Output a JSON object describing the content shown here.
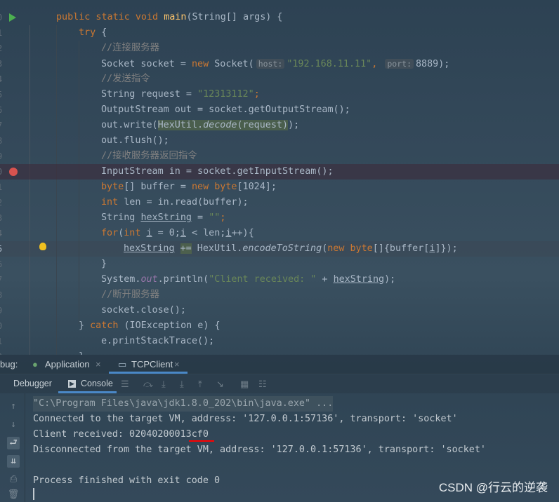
{
  "editor": {
    "line_numbers": [
      "0",
      "1",
      "2",
      "3",
      "4",
      "5",
      "6",
      "7",
      "8",
      "9",
      "0",
      "1",
      "2",
      "3",
      "4",
      "5",
      "6",
      "7",
      "8",
      "9",
      "0",
      "1",
      "2"
    ],
    "lines": [
      [
        [
          "public static void ",
          "kw"
        ],
        [
          "main",
          "fn"
        ],
        [
          "(String[] args) {",
          ""
        ]
      ],
      [
        [
          "try ",
          "kw"
        ],
        [
          "{",
          ""
        ]
      ],
      [
        [
          "//连接服务器",
          "cm"
        ]
      ],
      [
        [
          "Socket socket = ",
          ""
        ],
        [
          "new ",
          "kw"
        ],
        [
          "Socket(",
          ""
        ],
        [
          "host:",
          "hint"
        ],
        [
          "\"192.168.11.11\"",
          "str"
        ],
        [
          ", ",
          "kw"
        ],
        [
          "port:",
          "hint"
        ],
        [
          "8889",
          ""
        ],
        [
          ");",
          ""
        ]
      ],
      [
        [
          "//发送指令",
          "cm"
        ]
      ],
      [
        [
          "String request = ",
          ""
        ],
        [
          "\"12313112\"",
          "str"
        ],
        [
          ";",
          "kw"
        ]
      ],
      [
        [
          "OutputStream out = socket.getOutputStream();",
          ""
        ]
      ],
      [
        [
          "out.write(",
          ""
        ],
        [
          "HexUtil.",
          "hl"
        ],
        [
          "decode",
          "hl it"
        ],
        [
          "(request)",
          "hl"
        ],
        [
          ");",
          ""
        ]
      ],
      [
        [
          "out.flush();",
          ""
        ]
      ],
      [
        [
          "//接收服务器返回指令",
          "cm"
        ]
      ],
      [
        [
          "InputStream in = socket.getInputStream();",
          ""
        ]
      ],
      [
        [
          "byte",
          "kw"
        ],
        [
          "[] buffer = ",
          ""
        ],
        [
          "new byte",
          "kw"
        ],
        [
          "[1024];",
          ""
        ]
      ],
      [
        [
          "int ",
          "kw"
        ],
        [
          "len = in.read(buffer);",
          ""
        ]
      ],
      [
        [
          "String ",
          ""
        ],
        [
          "hexString",
          "ul"
        ],
        [
          " = ",
          ""
        ],
        [
          "\"\"",
          "str"
        ],
        [
          ";",
          "kw"
        ]
      ],
      [
        [
          "for",
          "kw"
        ],
        [
          "(",
          ""
        ],
        [
          "int ",
          "kw"
        ],
        [
          "i",
          "ul"
        ],
        [
          " = 0;",
          ""
        ],
        [
          "i",
          "ul"
        ],
        [
          " < len;",
          ""
        ],
        [
          "i",
          "ul"
        ],
        [
          "++){",
          ""
        ]
      ],
      [
        [
          "hexString",
          "ul"
        ],
        [
          " ",
          ""
        ],
        [
          "+=",
          "hl"
        ],
        [
          " HexUtil.",
          ""
        ],
        [
          "encodeToString",
          "it"
        ],
        [
          "(",
          ""
        ],
        [
          "new byte",
          "kw"
        ],
        [
          "[]{buffer[",
          ""
        ],
        [
          "i",
          "ul"
        ],
        [
          "]});",
          ""
        ]
      ],
      [
        [
          "}",
          ""
        ]
      ],
      [
        [
          "System.",
          ""
        ],
        [
          "out",
          "st"
        ],
        [
          ".println(",
          ""
        ],
        [
          "\"Client received: \"",
          "str"
        ],
        [
          " + ",
          ""
        ],
        [
          "hexString",
          "ul"
        ],
        [
          ");",
          ""
        ]
      ],
      [
        [
          "//断开服务器",
          "cm"
        ]
      ],
      [
        [
          "socket.close();",
          ""
        ]
      ],
      [
        [
          "} ",
          ""
        ],
        [
          "catch ",
          "kw"
        ],
        [
          "(IOException e) {",
          ""
        ]
      ],
      [
        [
          "e.printStackTrace();",
          ""
        ]
      ],
      [
        [
          "}",
          ""
        ]
      ]
    ],
    "indents": [
      0,
      1,
      2,
      2,
      2,
      2,
      2,
      2,
      2,
      2,
      2,
      2,
      2,
      2,
      2,
      3,
      2,
      2,
      2,
      2,
      1,
      2,
      1
    ]
  },
  "debug": {
    "label": "bug:",
    "tabs": [
      {
        "label": "Application",
        "icon": "spring-boot-icon"
      },
      {
        "label": "TCPClient",
        "icon": "window-icon",
        "active": true
      }
    ],
    "subtabs": [
      "Debugger",
      "Console"
    ]
  },
  "console": {
    "lines": [
      "\"C:\\Program Files\\java\\jdk1.8.0_202\\bin\\java.exe\" ...",
      "Connected to the target VM, address: '127.0.0.1:57136', transport: 'socket'",
      "Client received: 02040200013cf0",
      "Disconnected from the target VM, address: '127.0.0.1:57136', transport: 'socket'",
      "",
      "Process finished with exit code 0"
    ]
  },
  "watermark": "CSDN @行云的逆袭",
  "colors": {
    "keyword": "#cc7832",
    "string": "#6a8759",
    "comment": "#808080",
    "method": "#ffc66d",
    "text": "#a9b7c6",
    "breakpoint": "#d9534f",
    "run": "#4caf50",
    "underline_mark": "#ff0000"
  }
}
